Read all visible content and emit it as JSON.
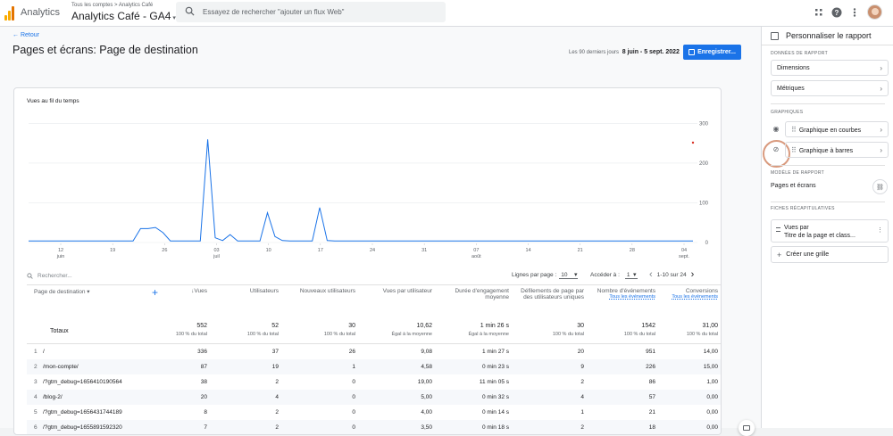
{
  "header": {
    "app_name": "Analytics",
    "breadcrumb": "Tous les comptes > Analytics Café",
    "property": "Analytics Café - GA4",
    "search_placeholder": "Essayez de rechercher \"ajouter un flux Web\"",
    "icons": [
      "apps-grid-icon",
      "help-icon",
      "more-vert-icon",
      "avatar"
    ]
  },
  "page": {
    "back": "Retour",
    "title": "Pages et écrans: Page de destination",
    "date_label": "Les 90 derniers jours",
    "date_range": "8 juin - 5 sept. 2022",
    "save_button": "Enregistrer..."
  },
  "chart_data": {
    "type": "line",
    "title": "Vues au fil du temps",
    "ylim": [
      0,
      310
    ],
    "y_ticks": [
      "300",
      "200",
      "100",
      "0"
    ],
    "x_ticks": [
      {
        "day": "12",
        "month": "juin"
      },
      {
        "day": "19",
        "month": ""
      },
      {
        "day": "26",
        "month": ""
      },
      {
        "day": "03",
        "month": "juil"
      },
      {
        "day": "10",
        "month": ""
      },
      {
        "day": "17",
        "month": ""
      },
      {
        "day": "24",
        "month": ""
      },
      {
        "day": "31",
        "month": ""
      },
      {
        "day": "07",
        "month": "août"
      },
      {
        "day": "14",
        "month": ""
      },
      {
        "day": "21",
        "month": ""
      },
      {
        "day": "28",
        "month": ""
      },
      {
        "day": "04",
        "month": "sept."
      }
    ],
    "series": [
      {
        "color": "#1a73e8",
        "values": [
          4,
          4,
          4,
          4,
          4,
          4,
          4,
          4,
          4,
          4,
          4,
          4,
          4,
          4,
          4,
          35,
          35,
          38,
          25,
          4,
          4,
          4,
          4,
          4,
          260,
          12,
          5,
          20,
          4,
          4,
          4,
          4,
          75,
          15,
          5,
          4,
          4,
          4,
          4,
          88,
          5,
          4,
          4,
          4,
          4,
          4,
          4,
          4,
          4,
          4,
          4,
          4,
          4,
          4,
          4,
          4,
          4,
          4,
          4,
          4,
          4,
          4,
          4,
          4,
          4,
          4,
          4,
          4,
          4,
          4,
          4,
          4,
          4,
          4,
          4,
          4,
          4,
          4,
          4,
          4,
          4,
          4,
          4,
          4,
          4,
          4,
          4,
          4,
          4,
          4
        ]
      }
    ]
  },
  "table": {
    "search_placeholder": "Rechercher...",
    "rows_per_page_label": "Lignes par page :",
    "rows_per_page": "10",
    "goto_label": "Accéder à :",
    "goto_value": "1",
    "page_info": "1-10 sur 24",
    "columns": [
      {
        "label": "Page de destination",
        "sub": ""
      },
      {
        "label": "↓Vues",
        "sub": ""
      },
      {
        "label": "Utilisateurs",
        "sub": ""
      },
      {
        "label": "Nouveaux utilisateurs",
        "sub": ""
      },
      {
        "label": "Vues par utilisateur",
        "sub": ""
      },
      {
        "label": "Durée d'engagement moyenne",
        "sub": ""
      },
      {
        "label": "Défilements de page par des utilisateurs uniques",
        "sub": ""
      },
      {
        "label": "Nombre d'événements",
        "sub": "Tous les événements"
      },
      {
        "label": "Conversions",
        "sub": "Tous les événements"
      }
    ],
    "totals": {
      "label": "Totaux",
      "cells": [
        {
          "value": "552",
          "note": "100 % du total"
        },
        {
          "value": "52",
          "note": "100 % du total"
        },
        {
          "value": "30",
          "note": "100 % du total"
        },
        {
          "value": "10,62",
          "note": "Égal à la moyenne"
        },
        {
          "value": "1 min 26 s",
          "note": "Égal à la moyenne"
        },
        {
          "value": "30",
          "note": "100 % du total"
        },
        {
          "value": "1542",
          "note": "100 % du total"
        },
        {
          "value": "31,00",
          "note": "100 % du total"
        }
      ]
    },
    "rows": [
      {
        "n": "1",
        "page": "/",
        "cells": [
          "336",
          "37",
          "26",
          "9,08",
          "1 min 27 s",
          "20",
          "951",
          "14,00"
        ]
      },
      {
        "n": "2",
        "page": "/mon-compte/",
        "cells": [
          "87",
          "19",
          "1",
          "4,58",
          "0 min 23 s",
          "9",
          "226",
          "15,00"
        ]
      },
      {
        "n": "3",
        "page": "/?gtm_debug=1656410190564",
        "cells": [
          "38",
          "2",
          "0",
          "19,00",
          "11 min 05 s",
          "2",
          "86",
          "1,00"
        ]
      },
      {
        "n": "4",
        "page": "/blog-2/",
        "cells": [
          "20",
          "4",
          "0",
          "5,00",
          "0 min 32 s",
          "4",
          "57",
          "0,00"
        ]
      },
      {
        "n": "5",
        "page": "/?gtm_debug=1656431744189",
        "cells": [
          "8",
          "2",
          "0",
          "4,00",
          "0 min 14 s",
          "1",
          "21",
          "0,00"
        ]
      },
      {
        "n": "6",
        "page": "/?gtm_debug=1655891592320",
        "cells": [
          "7",
          "2",
          "0",
          "3,50",
          "0 min 18 s",
          "2",
          "18",
          "0,00"
        ]
      }
    ]
  },
  "panel": {
    "title": "Personnaliser le rapport",
    "data_section": "DONNÉES DE RAPPORT",
    "dimensions": "Dimensions",
    "metrics": "Métriques",
    "charts_section": "GRAPHIQUES",
    "line_chart": "Graphique en courbes",
    "bar_chart": "Graphique à barres",
    "template_section": "MODÈLE DE RAPPORT",
    "template_name": "Pages et écrans",
    "summary_section": "FICHES RÉCAPITULATIVES",
    "summary_line1": "Vues par",
    "summary_line2": "Titre de la page et class...",
    "create_grid": "Créer une grille"
  }
}
